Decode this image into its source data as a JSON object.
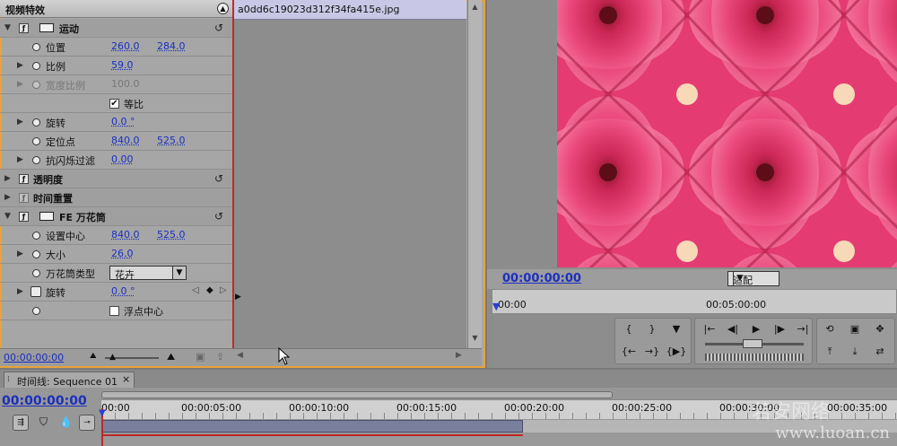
{
  "effects_panel": {
    "title": "视频特效",
    "clip_name": "a0dd6c19023d312f34fa415e.jpg",
    "footer_timecode": "00:00:00:00",
    "rows": {
      "motion": {
        "label": "运动"
      },
      "position": {
        "label": "位置",
        "x": "260.0",
        "y": "284.0"
      },
      "scale": {
        "label": "比例",
        "value": "59.0"
      },
      "scale_width": {
        "label": "宽度比例",
        "value": "100.0"
      },
      "uniform_scale": {
        "label": "等比",
        "checked": true
      },
      "rotation": {
        "label": "旋转",
        "value": "0.0 °"
      },
      "anchor": {
        "label": "定位点",
        "x": "840.0",
        "y": "525.0"
      },
      "antiflicker": {
        "label": "抗闪烁过滤",
        "value": "0.00"
      },
      "opacity": {
        "label": "透明度"
      },
      "time_remap": {
        "label": "时间重置"
      },
      "kaleido": {
        "label": "FE 万花筒"
      },
      "kaleido_center": {
        "label": "设置中心",
        "x": "840.0",
        "y": "525.0"
      },
      "kaleido_size": {
        "label": "大小",
        "value": "26.0"
      },
      "kaleido_type": {
        "label": "万花筒类型",
        "value": "花卉"
      },
      "kaleido_rotation": {
        "label": "旋转",
        "value": "0.0 °"
      },
      "float_center": {
        "label": "浮点中心",
        "checked": false
      }
    }
  },
  "monitor": {
    "timecode": "00:00:00:00",
    "fit_label": "适配",
    "ruler_start": "00:00",
    "ruler_mid": "00:05:00:00"
  },
  "timeline": {
    "tab_label": "时间线: Sequence 01",
    "close": "×",
    "timecode": "00:00:00:00",
    "ruler": [
      "00:00",
      "00:00:05:00",
      "00:00:10:00",
      "00:00:15:00",
      "00:00:20:00",
      "00:00:25:00",
      "00:00:30:00",
      "00:00:35:00"
    ]
  },
  "watermark": {
    "text": "www.luoan.cn",
    "seal": "若安网络"
  },
  "colors": {
    "panel_border": "#e8a33a",
    "timecode_blue": "#1b2fc0",
    "playhead_red": "#c0282a",
    "image_pink": "#e2356e"
  }
}
